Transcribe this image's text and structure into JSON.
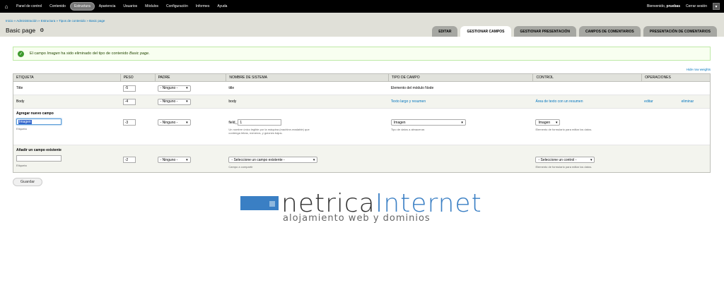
{
  "toolbar": {
    "items": [
      "Panel de control",
      "Contenido",
      "Estructura",
      "Apariencia",
      "Usuarios",
      "Módulos",
      "Configuración",
      "Informes",
      "Ayuda"
    ],
    "welcome": "Bienvenido,",
    "user": "pruebas",
    "logout": "Cerrar sesión"
  },
  "breadcrumb": "Inicio » Administración » Estructura » Tipos de contenido » Basic page",
  "page_title": "Basic page",
  "tabs": [
    "EDITAR",
    "GESTIONAR CAMPOS",
    "GESTIONAR PRESENTACIÓN",
    "CAMPOS DE COMENTARIOS",
    "PRESENTACIÓN DE COMENTARIOS"
  ],
  "message": {
    "pre": "El campo ",
    "field": "Imagen",
    "mid": " ha sido eliminado del tipo de contenido ",
    "type": "Basic page",
    "post": "."
  },
  "hide_weights": "Hide row weights",
  "table": {
    "headers": [
      "ETIQUETA",
      "PESO",
      "PADRE",
      "NOMBRE DE SISTEMA",
      "TIPO DE CAMPO",
      "CONTROL",
      "OPERACIONES"
    ],
    "rows": [
      {
        "label": "Title",
        "weight": "-5",
        "parent": "- Ninguno -",
        "system": "title",
        "type": "Elemento del módulo Node",
        "control": "",
        "edit": "",
        "delete": ""
      },
      {
        "label": "Body",
        "weight": "-4",
        "parent": "- Ninguno -",
        "system": "body",
        "type": "Texto largo y resumen",
        "control": "Área de texto con un resumen",
        "edit": "editar",
        "delete": "eliminar"
      }
    ],
    "new_field": {
      "title": "Agregar nuevo campo",
      "label_value": "Imagen",
      "label_desc": "Etiqueta",
      "weight": "-3",
      "parent": "- Ninguno -",
      "prefix": "field_",
      "name_value": "1",
      "name_desc": "Un nombre único legible por la máquina (machine-readable) que contenga letras, números, y guiones bajos.",
      "type_value": "Imagen",
      "type_desc": "Tipo de datos a almacenar.",
      "control_value": "Imagen",
      "control_desc": "Elemento de formulario para editar los datos."
    },
    "existing_field": {
      "title": "Añadir un campo existente",
      "label_desc": "Etiqueta",
      "weight": "-2",
      "parent": "- Ninguno -",
      "field_select": "- Seleccione un campo existente -",
      "field_desc": "Campo a compartir",
      "control_select": "- Seleccione un control -",
      "control_desc": "Elemento de formulario para editar los datos."
    }
  },
  "save_label": "Guardar",
  "logo": {
    "word1": "netrica",
    "word2": "Internet",
    "tagline": "alojamiento web y dominios",
    "colors": {
      "blue": "#3a7fc4",
      "dark": "#333333"
    }
  }
}
